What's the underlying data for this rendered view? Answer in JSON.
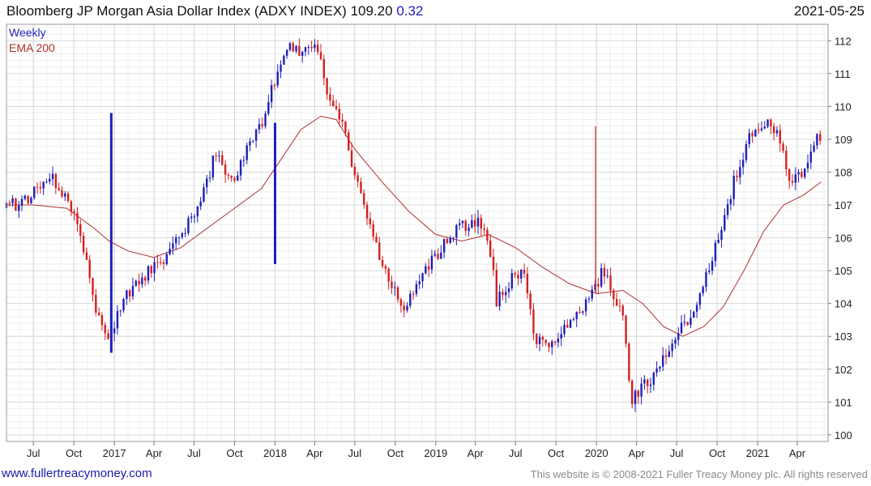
{
  "header": {
    "title": "Bloomberg JP Morgan Asia Dollar Index (ADXY INDEX)",
    "last_price": "109.20",
    "change": "0.32",
    "date": "2021-05-25"
  },
  "footer": {
    "link": "www.fullertreacymoney.com",
    "copyright": "This website is © 2008-2021 Fuller Treacy Money plc. All rights reserved"
  },
  "colors": {
    "up": "#1f1fb8",
    "down": "#d42020",
    "ema": "#b03030",
    "grid": "#e4e4e4"
  },
  "chart_data": {
    "type": "candlestick",
    "frequency": "Weekly",
    "legend": [
      "Weekly",
      "EMA 200"
    ],
    "legend_placement": "top-left",
    "yaxis_side": "right",
    "ylim": [
      99.8,
      112.5
    ],
    "yticks": [
      100,
      101,
      102,
      103,
      104,
      105,
      106,
      107,
      108,
      109,
      110,
      111,
      112
    ],
    "xlim": [
      "2016-05-01",
      "2021-06-10"
    ],
    "xticks": [
      {
        "date": "2016-07-01",
        "label": "Jul"
      },
      {
        "date": "2016-10-01",
        "label": "Oct"
      },
      {
        "date": "2017-01-01",
        "label": "2017"
      },
      {
        "date": "2017-04-01",
        "label": "Apr"
      },
      {
        "date": "2017-07-01",
        "label": "Jul"
      },
      {
        "date": "2017-10-01",
        "label": "Oct"
      },
      {
        "date": "2018-01-01",
        "label": "2018"
      },
      {
        "date": "2018-04-01",
        "label": "Apr"
      },
      {
        "date": "2018-07-01",
        "label": "Jul"
      },
      {
        "date": "2018-10-01",
        "label": "Oct"
      },
      {
        "date": "2019-01-01",
        "label": "2019"
      },
      {
        "date": "2019-04-01",
        "label": "Apr"
      },
      {
        "date": "2019-07-01",
        "label": "Jul"
      },
      {
        "date": "2019-10-01",
        "label": "Oct"
      },
      {
        "date": "2020-01-01",
        "label": "2020"
      },
      {
        "date": "2020-04-01",
        "label": "Apr"
      },
      {
        "date": "2020-07-01",
        "label": "Jul"
      },
      {
        "date": "2020-10-01",
        "label": "Oct"
      },
      {
        "date": "2021-01-01",
        "label": "2021"
      },
      {
        "date": "2021-04-01",
        "label": "Apr"
      }
    ],
    "price_path": [
      [
        "2016-05-01",
        106.9
      ],
      [
        "2016-06-15",
        107.2
      ],
      [
        "2016-08-01",
        107.9
      ],
      [
        "2016-09-10",
        107.4
      ],
      [
        "2016-10-15",
        106.2
      ],
      [
        "2016-11-25",
        103.6
      ],
      [
        "2016-12-25",
        103.0
      ],
      [
        "2017-01-20",
        104.2
      ],
      [
        "2017-03-01",
        104.8
      ],
      [
        "2017-04-15",
        105.3
      ],
      [
        "2017-05-20",
        105.8
      ],
      [
        "2017-06-20",
        106.5
      ],
      [
        "2017-07-25",
        107.5
      ],
      [
        "2017-08-25",
        108.8
      ],
      [
        "2017-09-20",
        107.6
      ],
      [
        "2017-10-20",
        108.4
      ],
      [
        "2017-12-01",
        109.5
      ],
      [
        "2018-01-25",
        111.8
      ],
      [
        "2018-03-01",
        111.6
      ],
      [
        "2018-04-05",
        111.9
      ],
      [
        "2018-05-01",
        110.2
      ],
      [
        "2018-06-01",
        109.5
      ],
      [
        "2018-07-01",
        107.8
      ],
      [
        "2018-08-10",
        106.0
      ],
      [
        "2018-09-10",
        105.0
      ],
      [
        "2018-10-20",
        103.8
      ],
      [
        "2018-11-20",
        104.5
      ],
      [
        "2018-12-20",
        105.2
      ],
      [
        "2019-01-25",
        106.0
      ],
      [
        "2019-03-01",
        106.4
      ],
      [
        "2019-04-10",
        106.5
      ],
      [
        "2019-05-01",
        106.0
      ],
      [
        "2019-05-20",
        104.0
      ],
      [
        "2019-06-20",
        104.7
      ],
      [
        "2019-07-20",
        105.0
      ],
      [
        "2019-08-15",
        103.0
      ],
      [
        "2019-09-15",
        102.5
      ],
      [
        "2019-10-15",
        103.2
      ],
      [
        "2019-11-15",
        103.8
      ],
      [
        "2019-12-15",
        104.0
      ],
      [
        "2020-01-15",
        105.0
      ],
      [
        "2020-02-10",
        104.2
      ],
      [
        "2020-03-01",
        103.8
      ],
      [
        "2020-03-20",
        101.0
      ],
      [
        "2020-04-15",
        101.6
      ],
      [
        "2020-05-15",
        101.8
      ],
      [
        "2020-06-15",
        102.8
      ],
      [
        "2020-07-15",
        103.3
      ],
      [
        "2020-08-15",
        104.0
      ],
      [
        "2020-09-15",
        105.2
      ],
      [
        "2020-10-15",
        106.5
      ],
      [
        "2020-11-20",
        108.3
      ],
      [
        "2020-12-20",
        109.2
      ],
      [
        "2021-01-15",
        109.6
      ],
      [
        "2021-02-15",
        109.2
      ],
      [
        "2021-03-15",
        107.8
      ],
      [
        "2021-04-10",
        108.0
      ],
      [
        "2021-05-25",
        109.2
      ]
    ],
    "spikes": [
      {
        "date": "2016-12-25",
        "high": 109.8,
        "low": 102.5,
        "dir": "up"
      },
      {
        "date": "2018-01-01",
        "high": 109.5,
        "low": 105.2,
        "dir": "up"
      },
      {
        "date": "2019-12-30",
        "high": 109.4,
        "low": 104.3,
        "dir": "down"
      }
    ],
    "ema_200": [
      [
        "2016-05-01",
        107.0
      ],
      [
        "2016-07-01",
        107.0
      ],
      [
        "2016-09-15",
        106.9
      ],
      [
        "2016-11-15",
        106.3
      ],
      [
        "2016-12-20",
        105.9
      ],
      [
        "2017-02-01",
        105.6
      ],
      [
        "2017-04-01",
        105.4
      ],
      [
        "2017-06-01",
        105.7
      ],
      [
        "2017-08-01",
        106.3
      ],
      [
        "2017-10-01",
        106.9
      ],
      [
        "2017-12-01",
        107.5
      ],
      [
        "2018-01-15",
        108.4
      ],
      [
        "2018-03-01",
        109.3
      ],
      [
        "2018-04-15",
        109.7
      ],
      [
        "2018-05-20",
        109.6
      ],
      [
        "2018-07-01",
        108.7
      ],
      [
        "2018-09-01",
        107.7
      ],
      [
        "2018-11-01",
        106.8
      ],
      [
        "2019-01-01",
        106.1
      ],
      [
        "2019-03-01",
        105.9
      ],
      [
        "2019-05-01",
        106.1
      ],
      [
        "2019-07-01",
        105.7
      ],
      [
        "2019-09-01",
        105.1
      ],
      [
        "2019-11-01",
        104.6
      ],
      [
        "2020-01-01",
        104.3
      ],
      [
        "2020-03-01",
        104.4
      ],
      [
        "2020-04-15",
        104.0
      ],
      [
        "2020-06-01",
        103.3
      ],
      [
        "2020-07-15",
        103.0
      ],
      [
        "2020-09-01",
        103.3
      ],
      [
        "2020-10-15",
        103.9
      ],
      [
        "2020-12-01",
        105.0
      ],
      [
        "2021-01-15",
        106.2
      ],
      [
        "2021-03-01",
        107.0
      ],
      [
        "2021-04-15",
        107.3
      ],
      [
        "2021-05-25",
        107.7
      ]
    ]
  }
}
